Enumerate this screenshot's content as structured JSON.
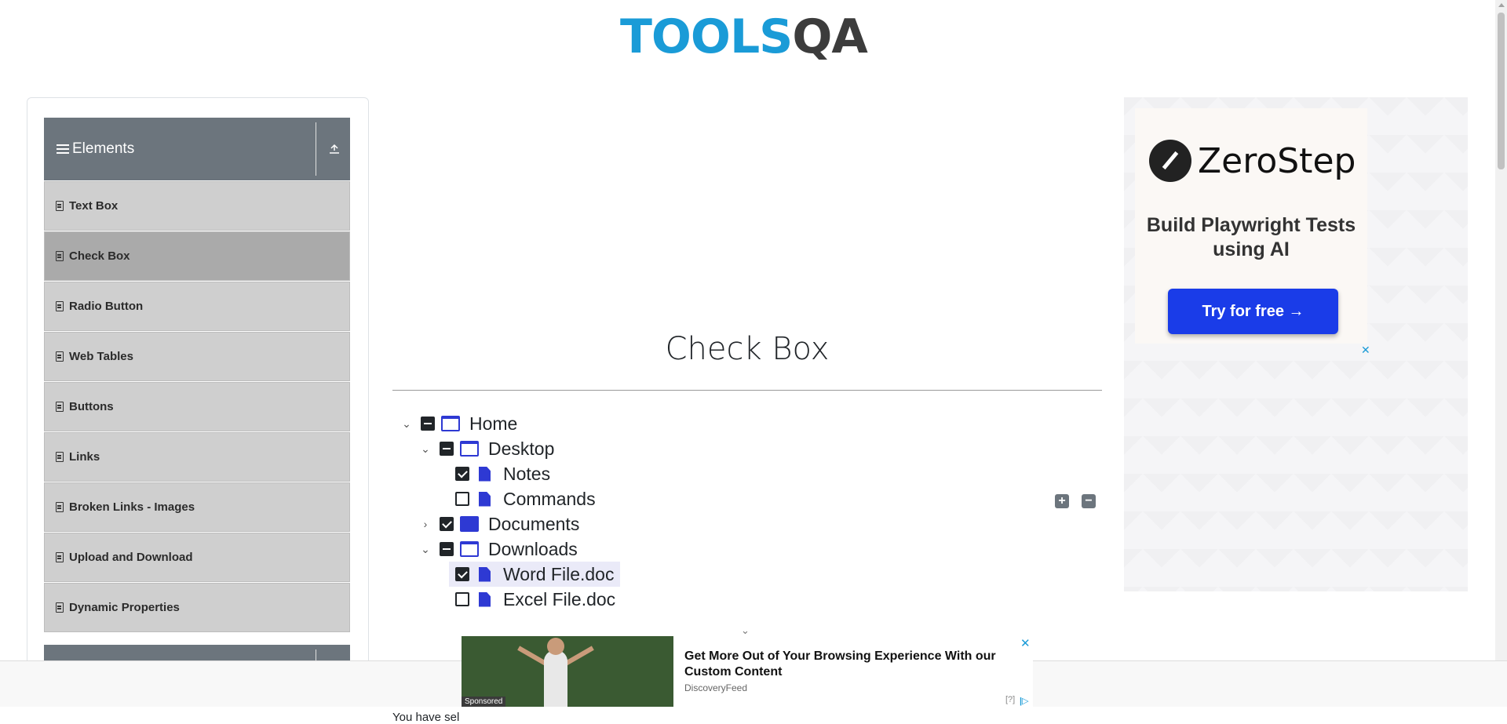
{
  "logo": {
    "part1": "TOOLS",
    "part2": "QA"
  },
  "sidebar": {
    "group_title": "Elements",
    "items": [
      {
        "label": "Text Box",
        "active": false
      },
      {
        "label": "Check Box",
        "active": true
      },
      {
        "label": "Radio Button",
        "active": false
      },
      {
        "label": "Web Tables",
        "active": false
      },
      {
        "label": "Buttons",
        "active": false
      },
      {
        "label": "Links",
        "active": false
      },
      {
        "label": "Broken Links - Images",
        "active": false
      },
      {
        "label": "Upload and Download",
        "active": false
      },
      {
        "label": "Dynamic Properties",
        "active": false
      }
    ]
  },
  "main": {
    "title": "Check Box",
    "tree": {
      "home": "Home",
      "desktop": "Desktop",
      "notes": "Notes",
      "commands": "Commands",
      "documents": "Documents",
      "downloads": "Downloads",
      "word": "Word File.doc",
      "excel": "Excel File.doc"
    },
    "expand_all": "+",
    "collapse_all": "−",
    "result_prefix": "You have sel"
  },
  "ad_right": {
    "brand": "ZeroStep",
    "headline": "Build Playwright Tests using AI",
    "cta": "Try for free →",
    "close": "✕"
  },
  "bottom_ad": {
    "title": "Get More Out of Your Browsing Experience With our Custom Content",
    "source": "DiscoveryFeed",
    "sponsored": "Sponsored",
    "close": "✕",
    "info": "[?]",
    "choices": "|▷"
  }
}
